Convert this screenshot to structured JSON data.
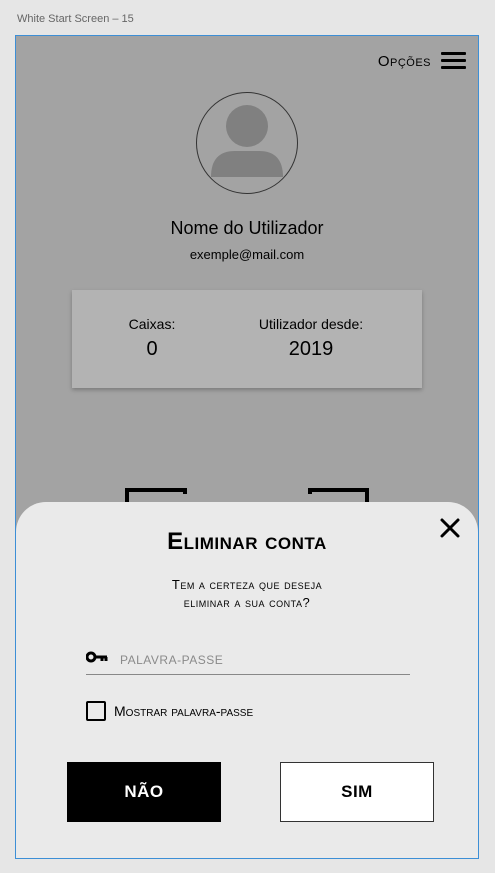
{
  "artboard": {
    "label": "White Start Screen – 15"
  },
  "header": {
    "menu_label": "Opções"
  },
  "profile": {
    "name": "Nome do Utilizador",
    "email": "exemple@mail.com"
  },
  "stats": {
    "boxes_label": "Caixas:",
    "boxes_value": "0",
    "since_label": "Utilizador desde:",
    "since_value": "2019"
  },
  "modal": {
    "title": "Eliminar conta",
    "message_line1": "Tem a certeza que deseja",
    "message_line2": "eliminar a sua conta?",
    "password_placeholder": "PALAVRA-PASSE",
    "password_value": "",
    "show_password_label": "Mostrar palavra-passe",
    "show_password_checked": false,
    "no_label": "NÃO",
    "yes_label": "SIM"
  },
  "icons": {
    "menu": "hamburger-icon",
    "avatar": "user-avatar-icon",
    "close": "close-icon",
    "key": "key-icon",
    "scan": "scan-frame-icon"
  },
  "colors": {
    "overlay_bg": "#a3a3a3",
    "card_bg": "#b3b3b3",
    "modal_bg": "#eaeaea",
    "primary_button": "#000000",
    "secondary_button": "#ffffff",
    "artboard_border": "#3d8fd6"
  }
}
